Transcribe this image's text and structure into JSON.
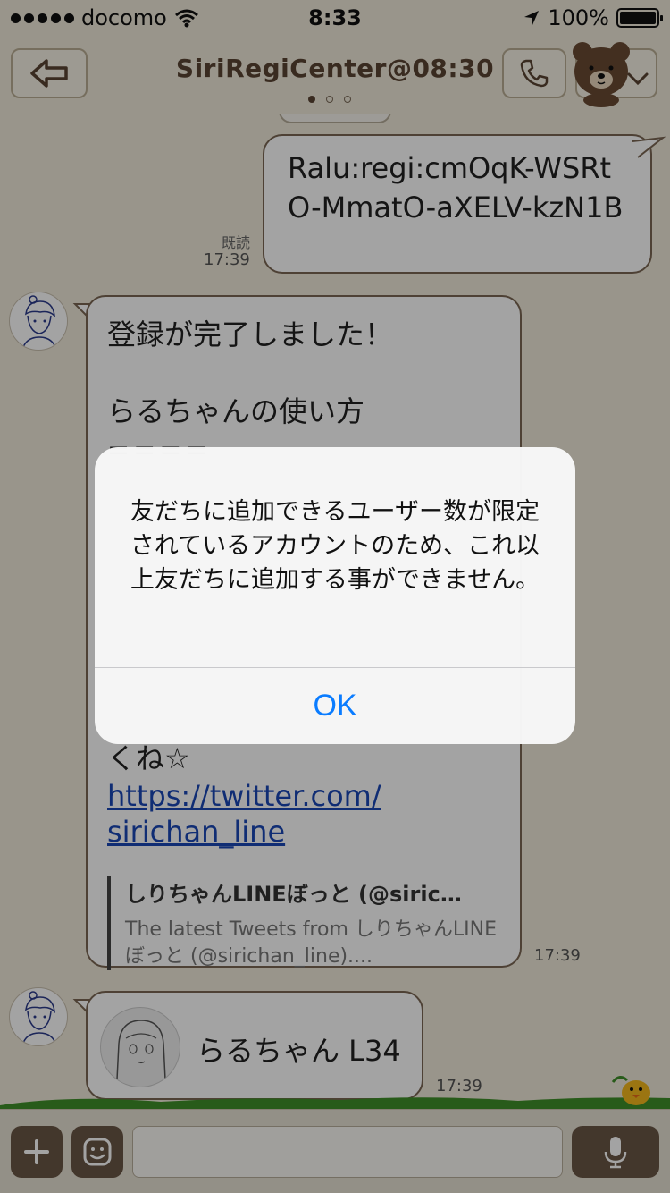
{
  "status_bar": {
    "carrier": "docomo",
    "time": "8:33",
    "battery": "100%"
  },
  "header": {
    "title": "SiriRegiCenter@08:30",
    "page_dots": 3,
    "active_page": 1
  },
  "messages": {
    "outgoing": {
      "text": "Ralu:regi:cmOqK-WSRtO-MmatO-aXELV-kzN1B",
      "read_label": "既読",
      "time": "17:39"
    },
    "incoming_1": {
      "line1": "登録が完了しました！",
      "line2": "らるちゃんの使い方",
      "rule": "====",
      "line_partial": "くね☆",
      "link_line1": "https://twitter.com/",
      "link_line2": "sirichan_line",
      "preview_title": "しりちゃんLINEぼっと (@siric…",
      "preview_desc": "The latest Tweets from しりちゃんLINEぼっと (@sirichan_line)....",
      "time": "17:39"
    },
    "incoming_2": {
      "contact_name": "らるちゃん L34",
      "time": "17:39"
    }
  },
  "input_bar": {
    "placeholder": ""
  },
  "alert": {
    "message": "友だちに追加できるユーザー数が限定されているアカウントのため、これ以上友だちに追加する事ができません。",
    "ok_label": "OK"
  },
  "colors": {
    "background": "#efe9d9",
    "header_text": "#5a4433",
    "bubble_border": "#7a6753",
    "link": "#1a47b6",
    "alert_button": "#0a7cff"
  }
}
